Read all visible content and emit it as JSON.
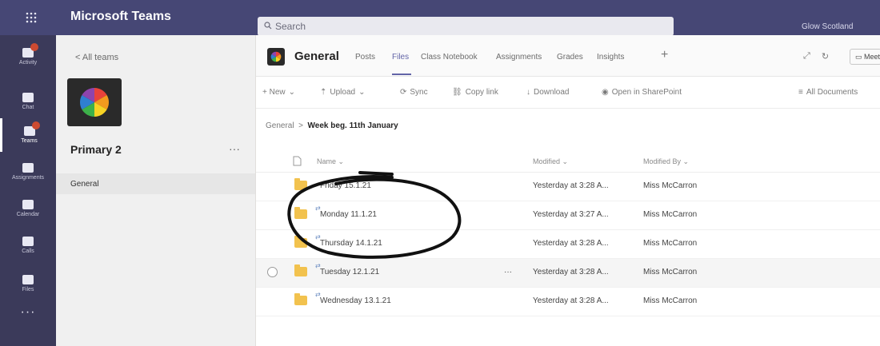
{
  "app": {
    "title": "Microsoft Teams"
  },
  "search": {
    "placeholder": "Search"
  },
  "user": {
    "name": "Glow Scotland"
  },
  "rail": {
    "items": [
      {
        "label": "Activity",
        "icon": "bell-icon"
      },
      {
        "label": "Chat",
        "icon": "chat-icon"
      },
      {
        "label": "Teams",
        "icon": "teams-icon"
      },
      {
        "label": "Assignments",
        "icon": "assignments-icon"
      },
      {
        "label": "Calendar",
        "icon": "calendar-icon"
      },
      {
        "label": "Calls",
        "icon": "phone-icon"
      },
      {
        "label": "Files",
        "icon": "files-icon"
      }
    ],
    "more": "···"
  },
  "teams_panel": {
    "back_label": "All teams",
    "team_name": "Primary 2",
    "team_more": "···",
    "channels": [
      {
        "label": "General"
      }
    ]
  },
  "channel": {
    "name": "General",
    "tabs": [
      "Posts",
      "Files",
      "Class Notebook",
      "Assignments",
      "Grades",
      "Insights"
    ],
    "active_tab": "Files",
    "add_tab": "+",
    "meet_label": "Meet"
  },
  "toolbar": {
    "new": "+ New",
    "upload": "Upload",
    "sync": "Sync",
    "copy_link": "Copy link",
    "download": "Download",
    "open_sharepoint": "Open in SharePoint",
    "all_documents": "All Documents"
  },
  "breadcrumb": {
    "root": "General",
    "current": "Week beg. 11th January"
  },
  "columns": {
    "name": "Name",
    "modified": "Modified",
    "modified_by": "Modified By"
  },
  "files": [
    {
      "name": "Friday 15.1.21",
      "modified": "Yesterday at 3:28 A...",
      "modified_by": "Miss McCarron"
    },
    {
      "name": "Monday 11.1.21",
      "modified": "Yesterday at 3:27 A...",
      "modified_by": "Miss McCarron"
    },
    {
      "name": "Thursday 14.1.21",
      "modified": "Yesterday at 3:28 A...",
      "modified_by": "Miss McCarron"
    },
    {
      "name": "Tuesday 12.1.21",
      "modified": "Yesterday at 3:28 A...",
      "modified_by": "Miss McCarron",
      "row_more": "···"
    },
    {
      "name": "Wednesday 13.1.21",
      "modified": "Yesterday at 3:28 A...",
      "modified_by": "Miss McCarron"
    }
  ],
  "colors": {
    "topbar": "#464775",
    "rail": "#3b3a5a",
    "accent": "#6264a7",
    "badge": "#cc4a31",
    "folder": "#f2c24e"
  }
}
